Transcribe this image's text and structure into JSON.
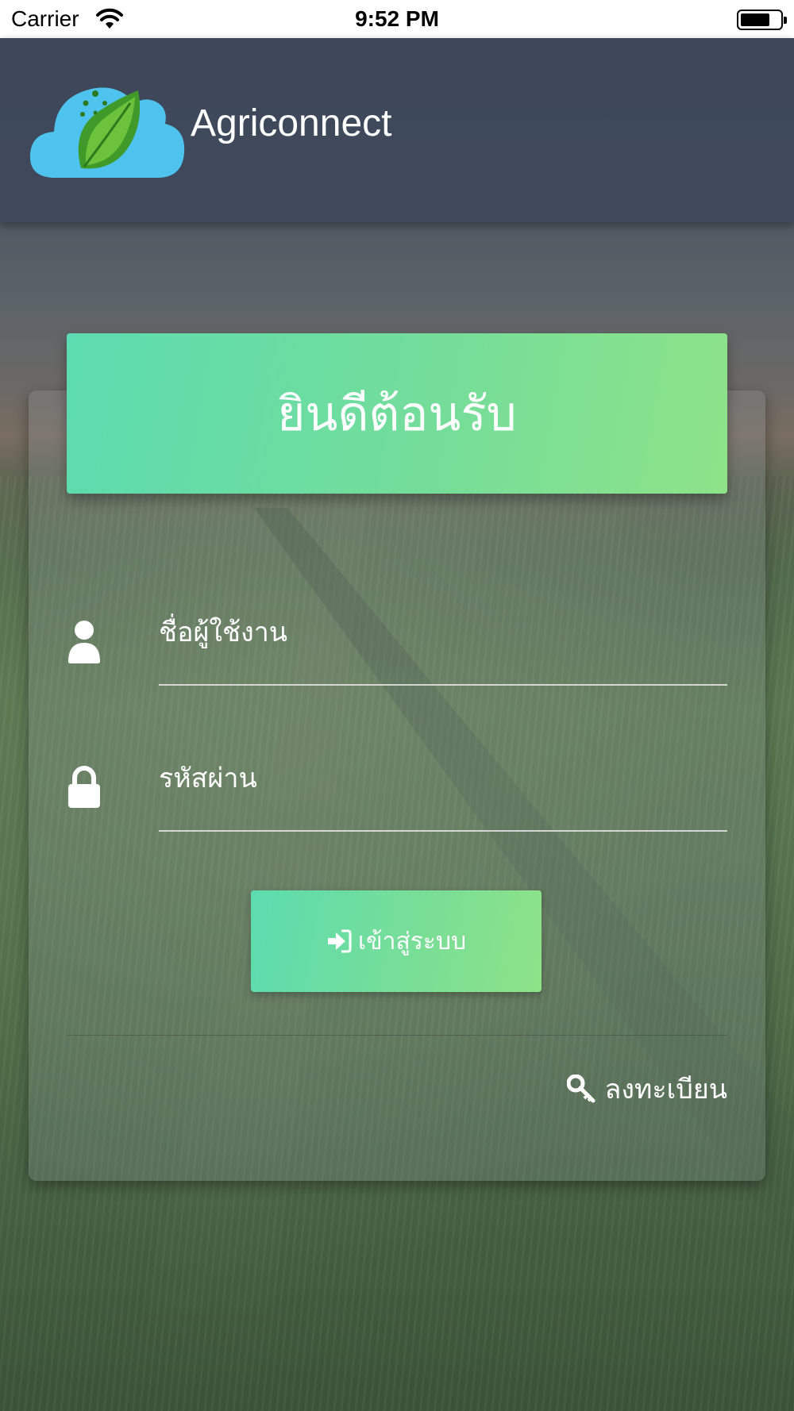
{
  "status_bar": {
    "carrier": "Carrier",
    "time": "9:52 PM"
  },
  "header": {
    "app_name": "Agriconnect",
    "logo_icon": "cloud-leaf-logo"
  },
  "card": {
    "welcome_title": "ยินดีต้อนรับ",
    "username": {
      "placeholder": "ชื่อผู้ใช้งาน",
      "value": "",
      "icon": "user-icon"
    },
    "password": {
      "placeholder": "รหัสผ่าน",
      "value": "",
      "icon": "lock-icon"
    },
    "login_button": {
      "label": "เข้าสู่ระบบ",
      "icon": "sign-in-icon"
    },
    "register_link": {
      "label": "ลงทะเบียน",
      "icon": "key-icon"
    }
  },
  "colors": {
    "accent_start": "#5cdcb0",
    "accent_end": "#8ee388",
    "header_bg": "#3c465a"
  }
}
